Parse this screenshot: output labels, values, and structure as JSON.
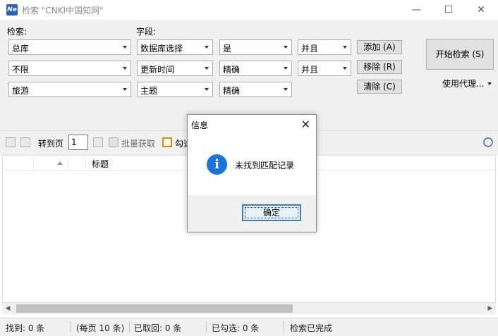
{
  "window": {
    "title": "检索 \"CNKI中国知网\"",
    "app_icon_text": "Ne",
    "minimize_glyph": "—",
    "maximize_glyph": "☐",
    "close_glyph": "✕"
  },
  "form": {
    "search_label": "检索:",
    "field_label": "字段:",
    "rows": [
      {
        "scope": "总库",
        "field": "数据库选择",
        "match": "是",
        "logic": "并且"
      },
      {
        "scope": "不限",
        "field": "更新时间",
        "match": "精确",
        "logic": "并且"
      },
      {
        "scope": "旅游",
        "field": "主题",
        "match": "精确"
      }
    ],
    "add_button": "添加 (A)",
    "remove_button": "移除 (R)",
    "clear_button": "清除 (C)",
    "start_button": "开始检索 (S)",
    "proxy_label": "使用代理..."
  },
  "toolbar": {
    "goto_page_label": "转到页",
    "page_value": "1",
    "batch_fetch_label": "批量获取",
    "check_label": "勾选"
  },
  "grid": {
    "columns": [
      "",
      "",
      "标题"
    ]
  },
  "status": {
    "found": "找到: 0 条",
    "per_page": "(每页 10 条)",
    "fetched": "已取回: 0 条",
    "checked": "已勾选: 0 条",
    "state": "检索已完成"
  },
  "dialog": {
    "title": "信息",
    "icon_glyph": "i",
    "message": "未找到匹配记录",
    "ok_button": "确定"
  },
  "colors": {
    "accent": "#1d74d8",
    "form_bg": "#f0f0f0",
    "dialog_ok_border": "#3c7fb1"
  }
}
